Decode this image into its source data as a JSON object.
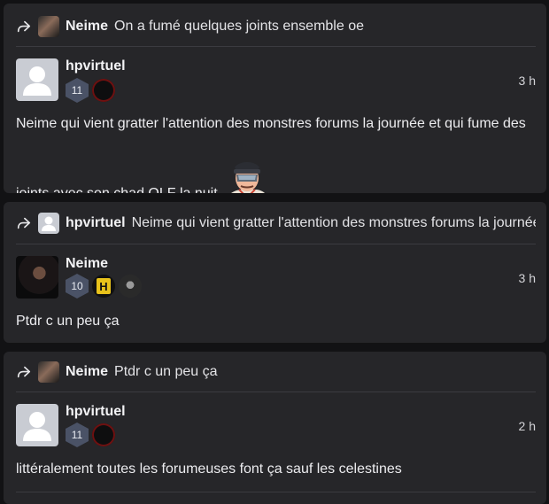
{
  "posts": [
    {
      "reply_to_user": "Neime",
      "reply_to_text": "On a fumé quelques joints ensemble oe",
      "author": "hpvirtuel",
      "level": "11",
      "time": "3 h",
      "text_line1": "Neime qui vient gratter l'attention des monstres forums la journée et qui fume des",
      "text_line2": "joints avec son chad QLF la nuit"
    },
    {
      "reply_to_user": "hpvirtuel",
      "reply_to_text": "Neime qui vient gratter l'attention des monstres forums la journée et qui fume des joints avec son chad QLF la nuit",
      "author": "Neime",
      "level": "10",
      "badge_letter": "H",
      "time": "3 h",
      "text": "Ptdr c un peu ça"
    },
    {
      "reply_to_user": "Neime",
      "reply_to_text": "Ptdr c un peu ça",
      "author": "hpvirtuel",
      "level": "11",
      "time": "2 h",
      "text": "littéralement toutes les forumeuses font ça sauf les celestines"
    }
  ],
  "icons": {
    "reply": "reply-arrow-icon",
    "default_avatar": "user-silhouette-icon"
  },
  "colors": {
    "card_bg": "#262629",
    "page_bg": "#121214",
    "level_badge": "#4a5266"
  }
}
